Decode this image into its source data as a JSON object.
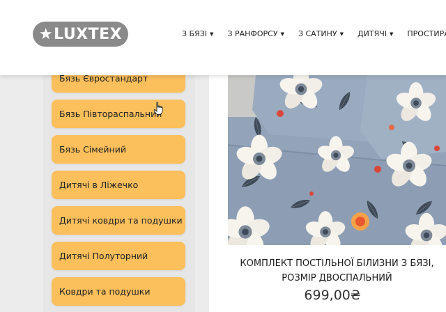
{
  "header": {
    "logo_text": "LUXTEX",
    "logo_star": "★",
    "nav": [
      {
        "label": "З БЯЗІ",
        "caret": "▼"
      },
      {
        "label": "З РАНФОРСУ",
        "caret": "▼"
      },
      {
        "label": "З САТИНУ",
        "caret": "▼"
      },
      {
        "label": "ДИТЯЧІ",
        "caret": "▼"
      },
      {
        "label": "ПРОСТИРАДЛА",
        "caret": ""
      }
    ]
  },
  "sidebar": {
    "categories": [
      "Бязь Євростандарт",
      "Бязь Півтораспальний",
      "Бязь Сімейний",
      "Дитячі в Ліжечко",
      "Дитячі ковдри та подушки",
      "Дитячі Полуторний",
      "Ковдри та подушки"
    ]
  },
  "product": {
    "title_line1": "КОМПЛЕКТ ПОСТІЛЬНОЇ БІЛИЗНИ З БЯЗІ,",
    "title_line2": "РОЗМІР ДВОСПАЛЬНИЙ",
    "price": "699,00₴",
    "image_icon": "floral-bedding-photo"
  },
  "colors": {
    "category_bg": "#fbbf5c",
    "logo_bg": "#8a8a8a",
    "fabric_bg": "#93a4b9"
  }
}
